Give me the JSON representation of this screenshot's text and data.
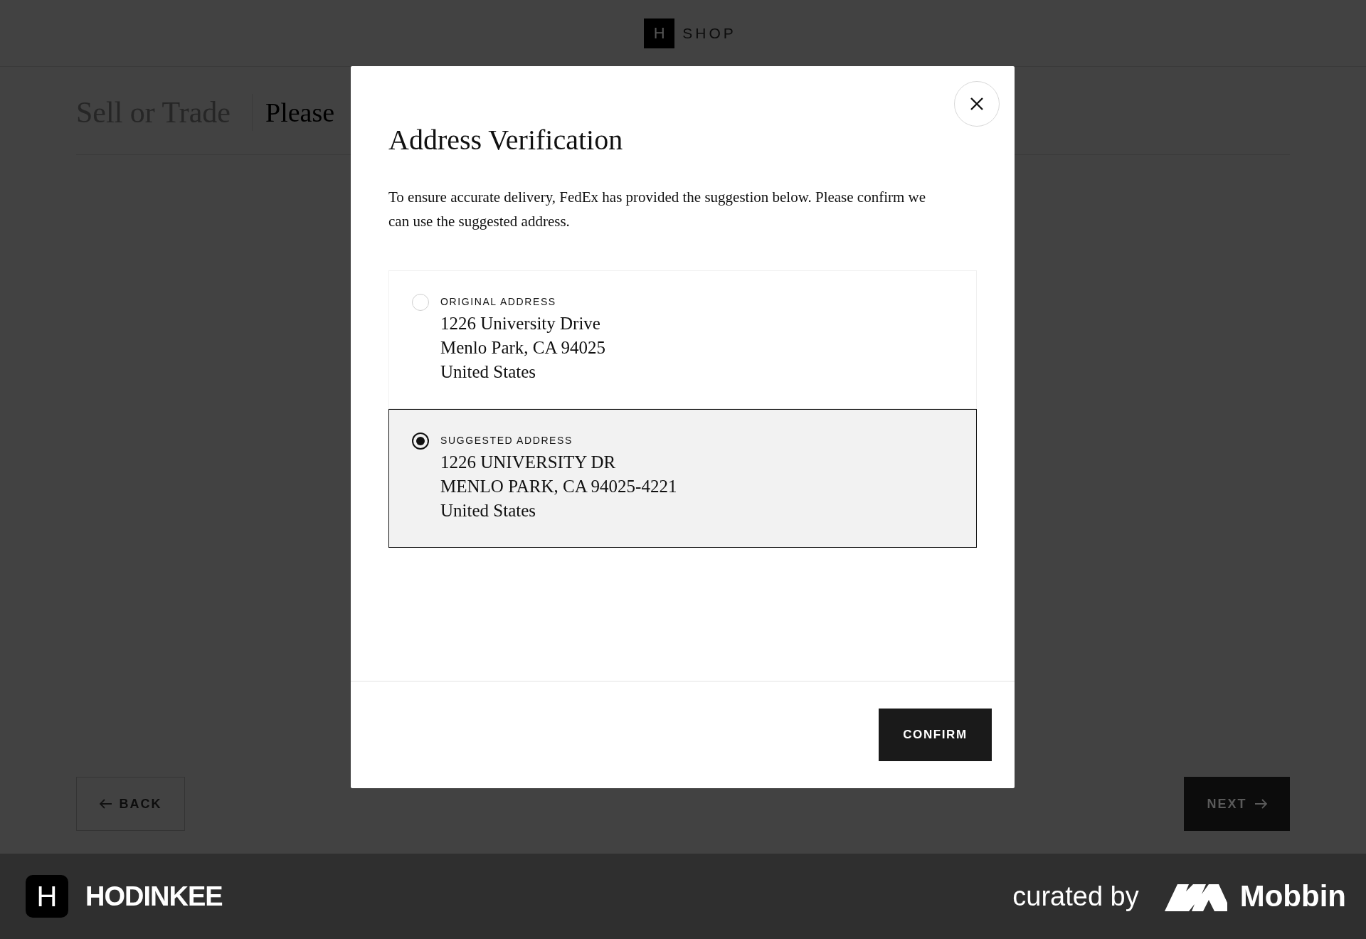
{
  "header": {
    "logo_letter": "H",
    "logo_text": "SHOP"
  },
  "page": {
    "title": "Sell or Trade",
    "subtitle": "Please"
  },
  "nav": {
    "back": "BACK",
    "next": "NEXT"
  },
  "modal": {
    "title": "Address Verification",
    "message": "To ensure accurate delivery, FedEx has provided the suggestion below. Please confirm we can use the suggested address.",
    "options": [
      {
        "label": "ORIGINAL ADDRESS",
        "lines": [
          "1226 University Drive",
          "Menlo Park, CA 94025",
          "United States"
        ],
        "selected": false
      },
      {
        "label": "SUGGESTED ADDRESS",
        "lines": [
          "1226 UNIVERSITY DR",
          "MENLO PARK, CA 94025-4221",
          "United States"
        ],
        "selected": true
      }
    ],
    "confirm": "CONFIRM"
  },
  "footer": {
    "brand_letter": "H",
    "brand": "HODINKEE",
    "curated": "curated by",
    "curator": "Mobbin"
  }
}
